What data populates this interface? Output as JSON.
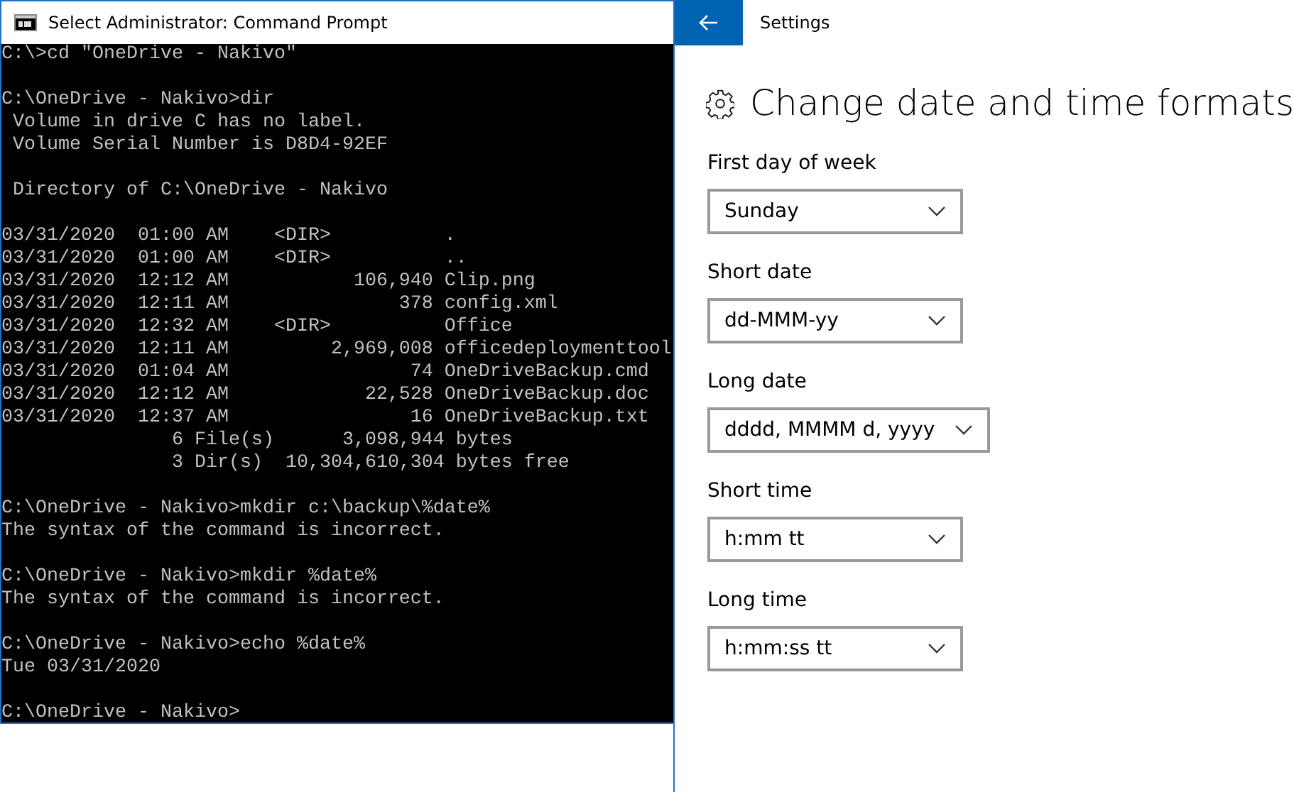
{
  "console_window": {
    "title": "Select Administrator: Command Prompt",
    "blocks": [
      [
        "C:\\>cd \"OneDrive - Nakivo\""
      ],
      [
        "C:\\OneDrive - Nakivo>dir",
        " Volume in drive C has no label.",
        " Volume Serial Number is D8D4-92EF"
      ],
      [
        " Directory of C:\\OneDrive - Nakivo"
      ],
      [
        "03/31/2020  01:00 AM    <DIR>          .",
        "03/31/2020  01:00 AM    <DIR>          ..",
        "03/31/2020  12:12 AM           106,940 Clip.png",
        "03/31/2020  12:11 AM               378 config.xml",
        "03/31/2020  12:32 AM    <DIR>          Office",
        "03/31/2020  12:11 AM         2,969,008 officedeploymenttool",
        "03/31/2020  01:04 AM                74 OneDriveBackup.cmd",
        "03/31/2020  12:12 AM            22,528 OneDriveBackup.doc",
        "03/31/2020  12:37 AM                16 OneDriveBackup.txt",
        "               6 File(s)      3,098,944 bytes",
        "               3 Dir(s)  10,304,610,304 bytes free"
      ],
      [
        "C:\\OneDrive - Nakivo>mkdir c:\\backup\\%date%",
        "The syntax of the command is incorrect."
      ],
      [
        "C:\\OneDrive - Nakivo>mkdir %date%",
        "The syntax of the command is incorrect."
      ],
      [
        "C:\\OneDrive - Nakivo>echo %date%",
        "Tue 03/31/2020"
      ],
      [
        "C:\\OneDrive - Nakivo>"
      ]
    ]
  },
  "settings_window": {
    "title": "Settings",
    "heading": "Change date and time formats",
    "fields": [
      {
        "label": "First day of week",
        "value": "Sunday"
      },
      {
        "label": "Short date",
        "value": "dd-MMM-yy"
      },
      {
        "label": "Long date",
        "value": "dddd, MMMM d, yyyy"
      },
      {
        "label": "Short time",
        "value": "h:mm tt"
      },
      {
        "label": "Long time",
        "value": "h:mm:ss tt"
      }
    ]
  }
}
